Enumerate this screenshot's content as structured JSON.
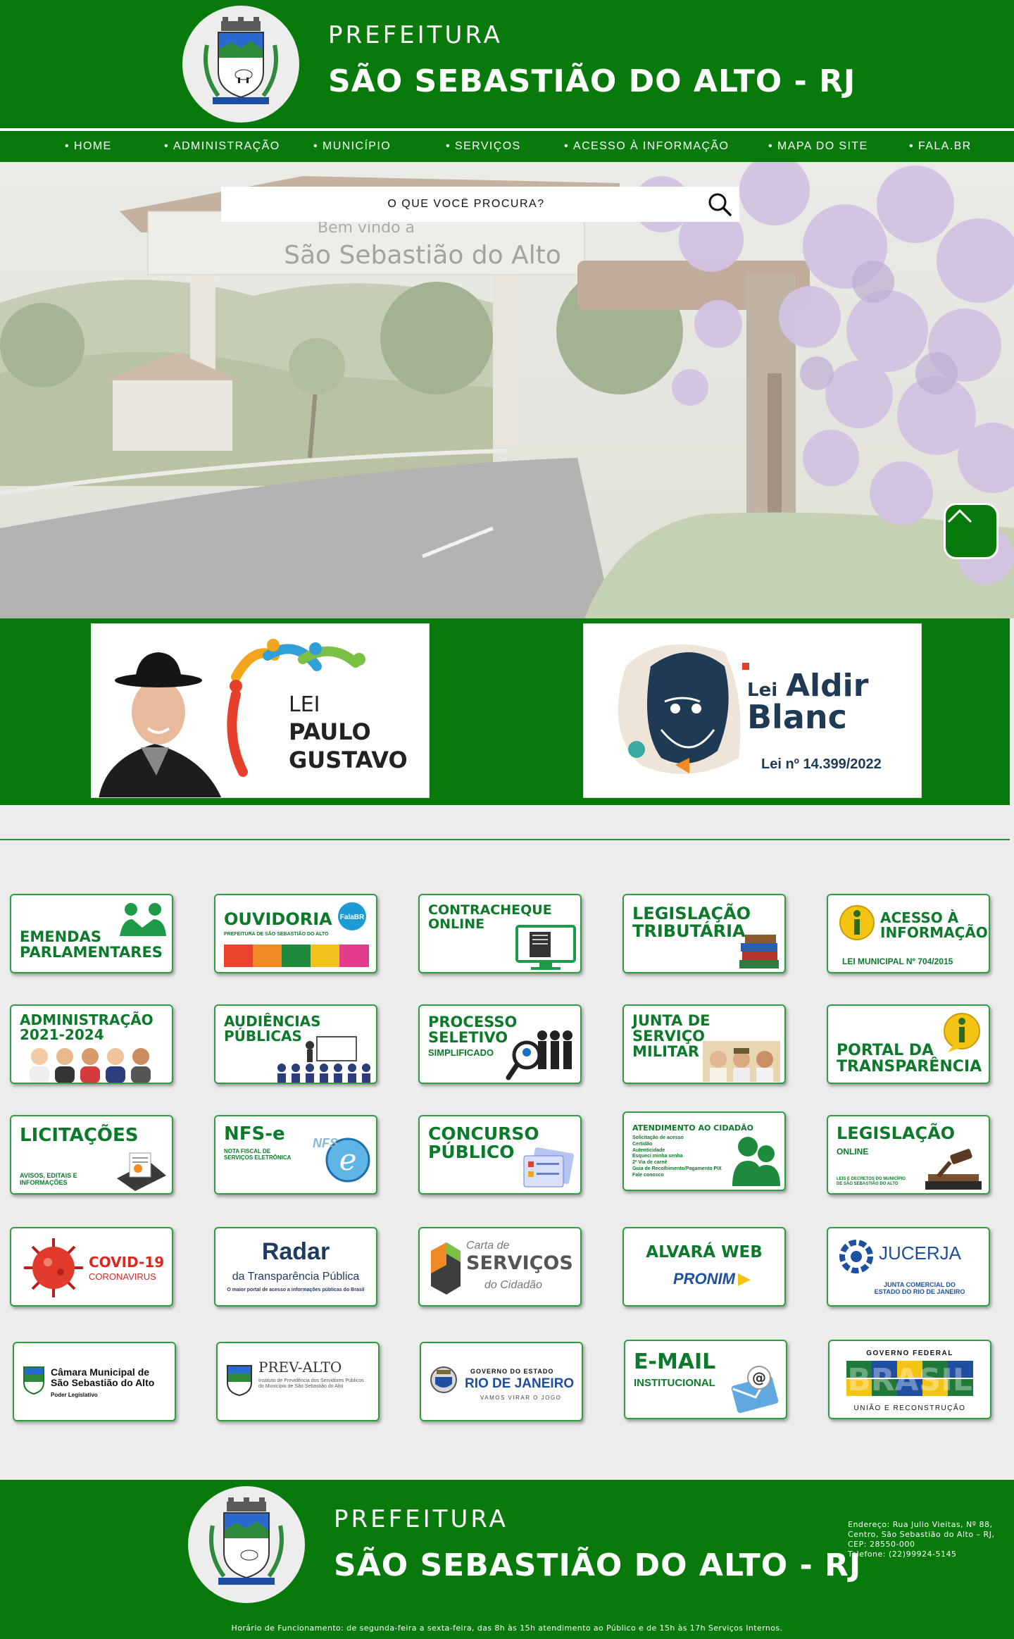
{
  "header": {
    "kicker": "PREFEITURA",
    "title": "SÃO SEBASTIÃO DO ALTO - RJ"
  },
  "nav": {
    "items": [
      {
        "label": "HOME"
      },
      {
        "label": "ADMINISTRAÇÃO"
      },
      {
        "label": "MUNICÍPIO"
      },
      {
        "label": "SERVIÇOS"
      },
      {
        "label": "ACESSO À INFORMAÇÃO"
      },
      {
        "label": "MAPA DO SITE"
      },
      {
        "label": "FALA.BR"
      }
    ]
  },
  "hero": {
    "sign_line1": "Bem vindo a",
    "sign_line2": "São Sebastião do Alto",
    "search_placeholder": "O QUE VOCÊ PROCURA?"
  },
  "laws": {
    "paulo": {
      "line1": "LEI",
      "line2": "PAULO",
      "line3": "GUSTAVO"
    },
    "aldir": {
      "prefix": "Lei",
      "name1": "Aldir",
      "name2": "Blanc",
      "number": "Lei nº 14.399/2022"
    }
  },
  "tiles": {
    "emendas": {
      "title": "EMENDAS\nPARLAMENTARES"
    },
    "ouvidoria": {
      "title": "OUVIDORIA",
      "subtitle": "PREFEITURA DE SÃO SEBASTIÃO DO ALTO",
      "badge": "FalaBR"
    },
    "contracheque": {
      "title": "CONTRACHEQUE\nONLINE"
    },
    "legislacao_trib": {
      "title": "LEGISLAÇÃO\nTRIBUTÁRIA"
    },
    "acesso": {
      "title": "ACESSO À\nINFORMAÇÃO",
      "subtitle": "LEI MUNICIPAL Nº 704/2015"
    },
    "administracao": {
      "title": "ADMINISTRAÇÃO\n2021-2024"
    },
    "audiencias": {
      "title": "AUDIÊNCIAS\nPÚBLICAS"
    },
    "processo": {
      "title": "PROCESSO\nSELETIVO",
      "subtitle": "SIMPLIFICADO"
    },
    "junta": {
      "title": "JUNTA DE SERVIÇO\nMILITAR"
    },
    "portal": {
      "title": "PORTAL DA\nTRANSPARÊNCIA"
    },
    "licitacoes": {
      "title": "LICITAÇÕES",
      "subtitle": "AVISOS, EDITAIS E\nINFORMAÇÕES"
    },
    "nfse": {
      "title": "NFS-e",
      "subtitle": "NOTA FISCAL DE\nSERVIÇOS ELETRÔNICA",
      "badge": "NFS"
    },
    "concurso": {
      "title": "CONCURSO\nPÚBLICO"
    },
    "atendimento": {
      "title": "ATENDIMENTO AO CIDADÃO",
      "subtitle": "Solicitação de acesso\nCertidão\nAutenticidade\nEsqueci minha senha\n2ª Via de carnê\nGuia de Recolhimento/Pagamento PIX\nFale conosco"
    },
    "legislacao_online": {
      "title": "LEGISLAÇÃO",
      "title2": "ONLINE",
      "subtitle": "LEIS E DECRETOS DO MUNICÍPIO\nDE SÃO SEBASTIÃO DO ALTO"
    },
    "covid": {
      "title": "COVID-19",
      "subtitle": "CORONAVIRUS"
    },
    "radar": {
      "title": "Radar",
      "title2": "da Transparência Pública",
      "subtitle": "O maior portal de acesso a informações públicas do Brasil"
    },
    "carta": {
      "title": "Carta de",
      "title2": "SERVIÇOS",
      "subtitle": "do Cidadão"
    },
    "alvara": {
      "title": "ALVARÁ WEB",
      "subtitle": "PRONIM"
    },
    "jucerja": {
      "title": "JUCERJA",
      "subtitle": "JUNTA COMERCIAL DO\nESTADO DO RIO DE JANEIRO"
    },
    "camara": {
      "title": "Câmara Municipal de\nSão Sebastião do Alto",
      "subtitle": "Poder Legislativo"
    },
    "prevalto": {
      "title": "PREV-ALTO",
      "subtitle": "Instituto de Previdência dos Servidores Públicos\ndo Município de São Sebastião do Alto"
    },
    "rio": {
      "kicker": "GOVERNO DO ESTADO",
      "title": "RIO DE JANEIRO",
      "subtitle": "VAMOS VIRAR O JOGO"
    },
    "email": {
      "title": "E-MAIL",
      "subtitle": "INSTITUCIONAL"
    },
    "brasil": {
      "kicker": "GOVERNO FEDERAL",
      "title": "BRASIL",
      "subtitle": "UNIÃO E RECONSTRUÇÃO"
    }
  },
  "footer": {
    "kicker": "PREFEITURA",
    "title": "SÃO SEBASTIÃO DO ALTO - RJ",
    "address_line1": "Endereço: Rua Julio Vieitas, Nº 88,",
    "address_line2": "Centro, São Sebastião do Alto – RJ,",
    "address_line3": "CEP: 28550-000",
    "address_line4": "Telefone: (22)99924-5145",
    "hours": "Horário de Funcionamento: de segunda-feira a sexta-feira, das 8h às 15h atendimento ao Público e de 15h às 17h Serviços Internos."
  },
  "colors": {
    "brand_green": "#077a0b",
    "tile_green": "#0c7a2a"
  }
}
